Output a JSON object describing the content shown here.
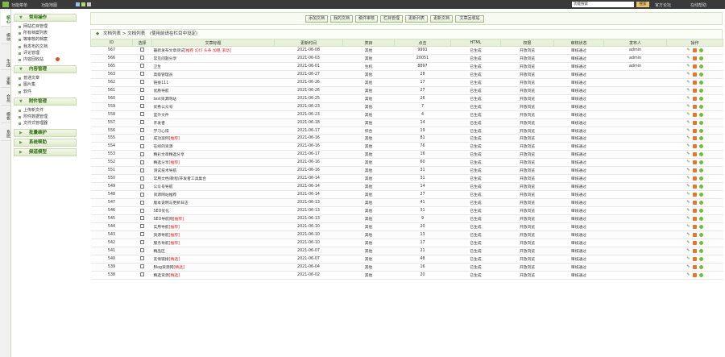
{
  "topbar": {
    "links": [
      "功能菜单",
      "功能地图"
    ],
    "keyword_placeholder": "功能搜索",
    "search_label": "搜索",
    "right_links": [
      "官方论坛",
      "在线帮助"
    ]
  },
  "vtabs": [
    "核心",
    "模块",
    "生成",
    "采集",
    "会员",
    "模板",
    "系统"
  ],
  "menu": {
    "groups": [
      {
        "title": "常用操作",
        "items": [
          "网站栏目管理",
          "所有档案列表",
          "等审核的档案",
          "我发布的文档",
          "评论管理",
          "内容回收站"
        ]
      },
      {
        "title": "内容管理",
        "items": [
          "普通文章",
          "图片集",
          "软件"
        ]
      },
      {
        "title": "附件管理",
        "items": [
          "上传新文件",
          "附件数据管理",
          "文件式管理器"
        ]
      },
      {
        "title": "批量维护"
      },
      {
        "title": "系统帮助"
      },
      {
        "title": "频道模型"
      }
    ]
  },
  "toolbar": {
    "buttons": [
      "添加文档",
      "我的文档",
      "稿件审核",
      "栏目管理",
      "更新列表",
      "更新文档",
      "文章回收站"
    ]
  },
  "breadcrumb": {
    "root": "文档列表",
    "current": "文档列表",
    "hint": "(使用前请在栏目中设定)"
  },
  "table": {
    "columns": [
      "ID",
      "选择",
      "文章标题",
      "更新时间",
      "类目",
      "点击",
      "HTML",
      "权限",
      "审核状态",
      "发布人",
      "操作"
    ],
    "rows": [
      {
        "id": "567",
        "title": "最新发布文章测试",
        "flag": "[推荐 幻灯 头条 加粗 滚动]",
        "date": "2021-06-08",
        "cat": "其他",
        "hits": "9991",
        "html": "已生成",
        "perm": "开放浏览",
        "status": "审核通过",
        "author": "admin"
      },
      {
        "id": "566",
        "title": "常见问题分享",
        "flag": "",
        "date": "2021-06-03",
        "cat": "其他",
        "hits": "20051",
        "html": "已生成",
        "perm": "开放浏览",
        "status": "审核通过",
        "author": "admin"
      },
      {
        "id": "565",
        "title": "卫生",
        "flag": "",
        "date": "2021-06-01",
        "cat": "生机",
        "hits": "8897",
        "html": "已生成",
        "perm": "开放浏览",
        "status": "审核通过",
        "author": "admin"
      },
      {
        "id": "563",
        "title": "高级管理员",
        "flag": "",
        "date": "2021-06-27",
        "cat": "其他",
        "hits": "28",
        "html": "已生成",
        "perm": "开放浏览",
        "status": "审核通过",
        "author": ""
      },
      {
        "id": "562",
        "title": "链接111",
        "flag": "",
        "date": "2021-06-26",
        "cat": "其他",
        "hits": "17",
        "html": "已生成",
        "perm": "开放浏览",
        "status": "审核通过",
        "author": ""
      },
      {
        "id": "561",
        "title": "优质导航",
        "flag": "",
        "date": "2021-06-26",
        "cat": "其他",
        "hits": "27",
        "html": "已生成",
        "perm": "开放浏览",
        "status": "审核通过",
        "author": ""
      },
      {
        "id": "560",
        "title": "test资源网站",
        "flag": "",
        "date": "2021-06-25",
        "cat": "其他",
        "hits": "26",
        "html": "已生成",
        "perm": "开放浏览",
        "status": "审核通过",
        "author": ""
      },
      {
        "id": "559",
        "title": "优秀公众号",
        "flag": "",
        "date": "2021-06-23",
        "cat": "其他",
        "hits": "7",
        "html": "已生成",
        "perm": "开放浏览",
        "status": "审核通过",
        "author": ""
      },
      {
        "id": "558",
        "title": "室外文件",
        "flag": "",
        "date": "2021-06-23",
        "cat": "其他",
        "hits": "4",
        "html": "已生成",
        "perm": "开放浏览",
        "status": "审核通过",
        "author": ""
      },
      {
        "id": "557",
        "title": "开发者",
        "flag": "",
        "date": "2021-06-18",
        "cat": "其他",
        "hits": "14",
        "html": "已生成",
        "perm": "开放浏览",
        "status": "审核通过",
        "author": ""
      },
      {
        "id": "556",
        "title": "学习心得",
        "flag": "",
        "date": "2021-06-17",
        "cat": "综合",
        "hits": "19",
        "html": "已生成",
        "perm": "开放浏览",
        "status": "审核通过",
        "author": ""
      },
      {
        "id": "555",
        "title": "成功案例",
        "flag": "[推荐]",
        "date": "2021-06-16",
        "cat": "其他",
        "hits": "81",
        "html": "已生成",
        "perm": "开放浏览",
        "status": "审核通过",
        "author": ""
      },
      {
        "id": "554",
        "title": "在线的资源",
        "flag": "",
        "date": "2021-06-16",
        "cat": "其他",
        "hits": "76",
        "html": "已生成",
        "perm": "开放浏览",
        "status": "审核通过",
        "author": ""
      },
      {
        "id": "553",
        "title": "精彩文章精选分享",
        "flag": "",
        "date": "2021-06-17",
        "cat": "其他",
        "hits": "16",
        "html": "已生成",
        "perm": "开放浏览",
        "status": "审核通过",
        "author": ""
      },
      {
        "id": "552",
        "title": "精选分享",
        "flag": "[推荐]",
        "date": "2021-06-16",
        "cat": "其他",
        "hits": "60",
        "html": "已生成",
        "perm": "开放浏览",
        "status": "审核通过",
        "author": ""
      },
      {
        "id": "551",
        "title": "测试技术导航",
        "flag": "",
        "date": "2021-06-16",
        "cat": "其他",
        "hits": "31",
        "html": "已生成",
        "perm": "开放浏览",
        "status": "审核通过",
        "author": ""
      },
      {
        "id": "550",
        "title": "常用文档/教程/开发者工具集合",
        "flag": "",
        "date": "2021-06-14",
        "cat": "其他",
        "hits": "31",
        "html": "已生成",
        "perm": "开放浏览",
        "status": "审核通过",
        "author": ""
      },
      {
        "id": "549",
        "title": "公众号导航",
        "flag": "",
        "date": "2021-06-14",
        "cat": "其他",
        "hits": "14",
        "html": "已生成",
        "perm": "开放浏览",
        "status": "审核通过",
        "author": ""
      },
      {
        "id": "548",
        "title": "资源网站推荐",
        "flag": "",
        "date": "2021-06-14",
        "cat": "其他",
        "hits": "27",
        "html": "已生成",
        "perm": "开放浏览",
        "status": "审核通过",
        "author": ""
      },
      {
        "id": "547",
        "title": "版本说明与更新日志",
        "flag": "",
        "date": "2021-06-13",
        "cat": "其他",
        "hits": "41",
        "html": "已生成",
        "perm": "开放浏览",
        "status": "审核通过",
        "author": ""
      },
      {
        "id": "546",
        "title": "SEO优化",
        "flag": "",
        "date": "2021-06-13",
        "cat": "其他",
        "hits": "31",
        "html": "已生成",
        "perm": "开放浏览",
        "status": "审核通过",
        "author": ""
      },
      {
        "id": "545",
        "title": "SEO导航网",
        "flag": "[推荐]",
        "date": "2021-06-13",
        "cat": "其他",
        "hits": "9",
        "html": "已生成",
        "perm": "开放浏览",
        "status": "审核通过",
        "author": ""
      },
      {
        "id": "544",
        "title": "实用导航",
        "flag": "[推荐]",
        "date": "2021-06-10",
        "cat": "其他",
        "hits": "20",
        "html": "已生成",
        "perm": "开放浏览",
        "status": "审核通过",
        "author": ""
      },
      {
        "id": "543",
        "title": "资源导航",
        "flag": "[推荐]",
        "date": "2021-06-10",
        "cat": "其他",
        "hits": "13",
        "html": "已生成",
        "perm": "开放浏览",
        "status": "审核通过",
        "author": ""
      },
      {
        "id": "542",
        "title": "服务导航",
        "flag": "[推荐]",
        "date": "2021-06-10",
        "cat": "其他",
        "hits": "17",
        "html": "已生成",
        "perm": "开放浏览",
        "status": "审核通过",
        "author": ""
      },
      {
        "id": "541",
        "title": "精品区",
        "flag": "",
        "date": "2021-06-07",
        "cat": "其他",
        "hits": "21",
        "html": "已生成",
        "perm": "开放浏览",
        "status": "审核通过",
        "author": ""
      },
      {
        "id": "540",
        "title": "友情链接",
        "flag": "[精选]",
        "date": "2021-06-07",
        "cat": "其他",
        "hits": "48",
        "html": "已生成",
        "perm": "开放浏览",
        "status": "审核通过",
        "author": ""
      },
      {
        "id": "539",
        "title": "Blog资源网",
        "flag": "[精选]",
        "date": "2021-06-04",
        "cat": "其他",
        "hits": "16",
        "html": "已生成",
        "perm": "开放浏览",
        "status": "审核通过",
        "author": ""
      },
      {
        "id": "538",
        "title": "精选资源",
        "flag": "[精选]",
        "date": "2021-06-02",
        "cat": "其他",
        "hits": "20",
        "html": "已生成",
        "perm": "开放浏览",
        "status": "审核通过",
        "author": ""
      }
    ]
  }
}
